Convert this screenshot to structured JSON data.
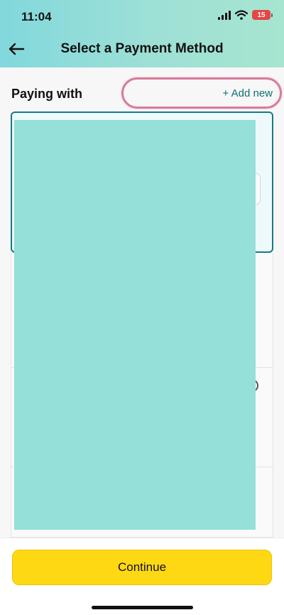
{
  "status_bar": {
    "time": "11:04",
    "battery": "15"
  },
  "header": {
    "title": "Select a Payment Method",
    "back_icon": "arrow-left-icon"
  },
  "section": {
    "label": "Paying with",
    "add_new": "+ Add new"
  },
  "footer": {
    "continue_label": "Continue"
  },
  "colors": {
    "accent": "#157a83",
    "button": "#ffd814",
    "highlight": "#d97b99",
    "redaction": "#95e0d8"
  }
}
